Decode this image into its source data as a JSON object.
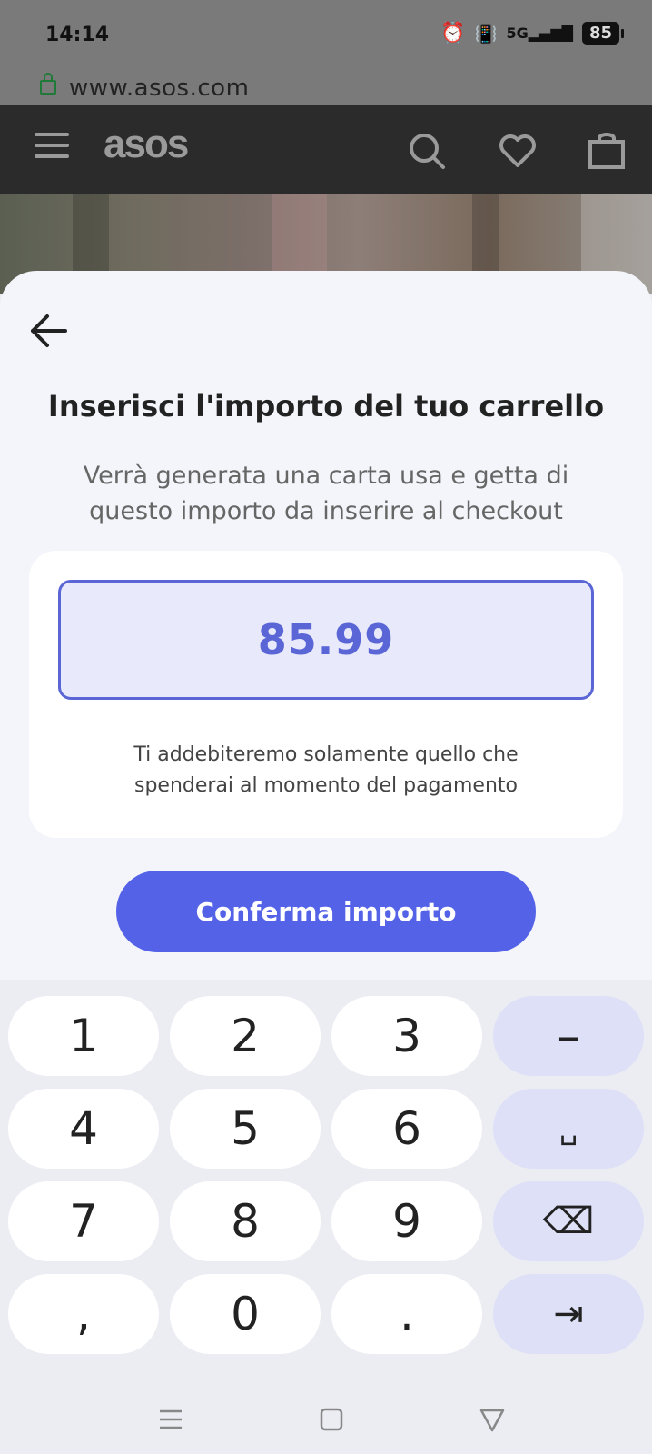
{
  "status_bar": {
    "time": "14:14",
    "network": "5G",
    "battery": "85"
  },
  "browser": {
    "url": "www.asos.com"
  },
  "header": {
    "logo": "asos"
  },
  "sheet": {
    "title": "Inserisci l'importo del tuo carrello",
    "subtitle_line1": "Verrà generata una carta usa e getta di",
    "subtitle_line2": "questo importo da inserire al checkout",
    "amount": "85.99",
    "note_line1": "Ti addebiteremo solamente quello che",
    "note_line2": "spenderai al momento del pagamento",
    "confirm_label": "Conferma importo"
  },
  "keyboard": {
    "row1": [
      "1",
      "2",
      "3",
      "–"
    ],
    "row2": [
      "4",
      "5",
      "6",
      "␣"
    ],
    "row3": [
      "7",
      "8",
      "9",
      "⌫"
    ],
    "row4": [
      ",",
      "0",
      ".",
      "⇥"
    ]
  },
  "colors": {
    "accent": "#5462e8",
    "amount_text": "#5a66d6",
    "amount_bg": "#e8e9fb"
  }
}
